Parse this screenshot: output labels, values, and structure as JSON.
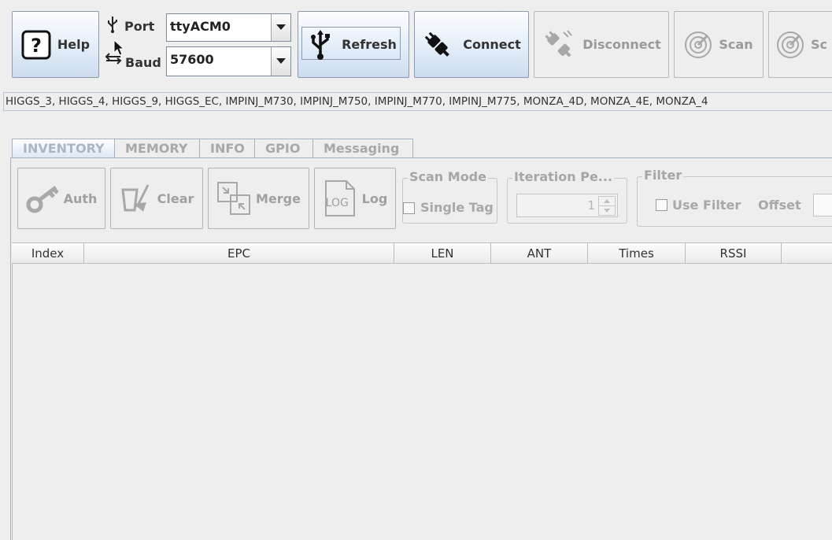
{
  "toolbar": {
    "help_label": "Help",
    "port_label": "Port",
    "baud_label": "Baud",
    "port_value": "ttyACM0",
    "baud_value": "57600",
    "refresh_label": "Refresh",
    "connect_label": "Connect",
    "disconnect_label": "Disconnect",
    "scan_label": "Scan",
    "scan2_label": "Sc"
  },
  "chip_list": "HIGGS_3, HIGGS_4, HIGGS_9, HIGGS_EC, IMPINJ_M730, IMPINJ_M750, IMPINJ_M770, IMPINJ_M775, MONZA_4D, MONZA_4E, MONZA_4",
  "tabs": [
    {
      "label": "INVENTORY"
    },
    {
      "label": "MEMORY"
    },
    {
      "label": "INFO"
    },
    {
      "label": "GPIO"
    },
    {
      "label": "Messaging"
    }
  ],
  "inventory": {
    "auth_label": "Auth",
    "clear_label": "Clear",
    "merge_label": "Merge",
    "log_label": "Log",
    "log_icon_text": "LOG",
    "scan_mode": {
      "legend": "Scan Mode",
      "single_tag_label": "Single Tag"
    },
    "iteration": {
      "legend": "Iteration Pe...",
      "value": "1"
    },
    "filter": {
      "legend": "Filter",
      "use_filter_label": "Use Filter",
      "offset_label": "Offset"
    }
  },
  "table": {
    "columns": [
      "Index",
      "EPC",
      "LEN",
      "ANT",
      "Times",
      "RSSI"
    ],
    "rows": []
  },
  "colors": {
    "accent": "#cddcee",
    "background": "#eeeeee",
    "disabled_text": "#a0a0a0"
  }
}
